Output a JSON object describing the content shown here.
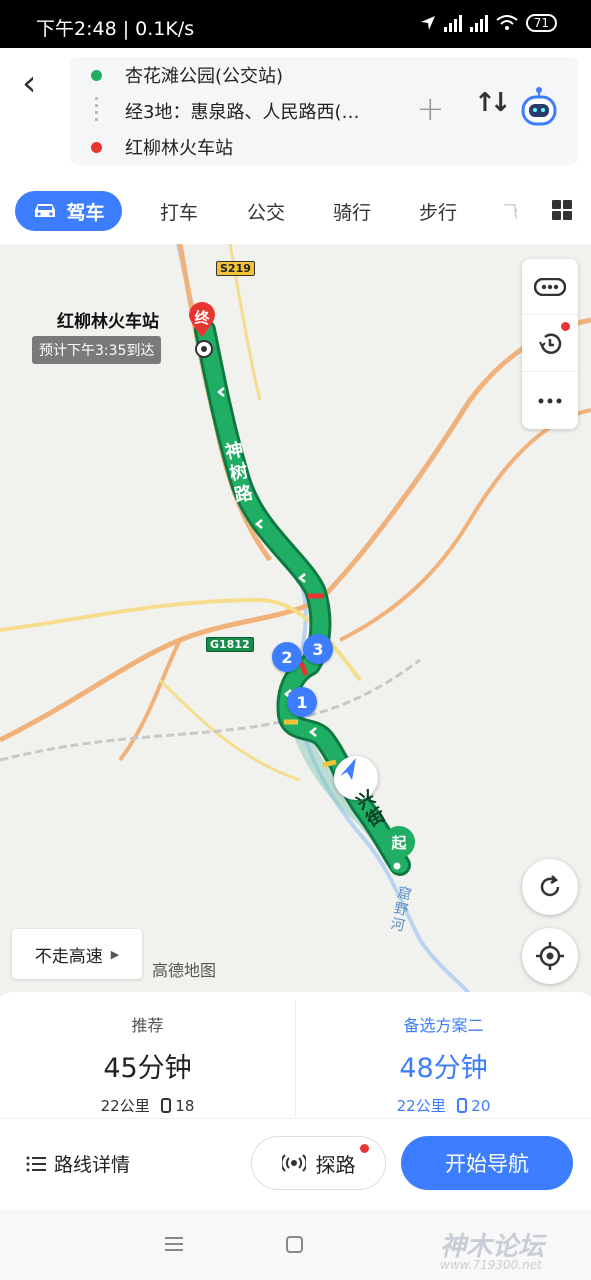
{
  "status_bar": {
    "time": "下午2:48 | 0.1K/s",
    "battery": "71"
  },
  "route": {
    "origin": "杏花滩公园(公交站)",
    "waypoints": "经3地：惠泉路、人民路西(…",
    "destination": "红柳林火车站"
  },
  "modes": {
    "active": "驾车",
    "items": [
      "打车",
      "公交",
      "骑行",
      "步行",
      "飞"
    ]
  },
  "map": {
    "dest_label": "红柳林火车站",
    "dest_marker": "终",
    "origin_marker": "起",
    "eta": "预计下午3:35到达",
    "road_names": [
      "神树路",
      "兴街"
    ],
    "shields": {
      "s219": "S219",
      "g1812": "G1812"
    },
    "waypoint_bubbles": [
      "1",
      "2",
      "3"
    ],
    "river_label": "窟野河",
    "no_highway": "不走高速",
    "logo": "高德地图"
  },
  "routes": [
    {
      "label": "推荐",
      "duration": "45分钟",
      "distance": "22公里",
      "lights": "18",
      "color": "#222222"
    },
    {
      "label": "备选方案二",
      "duration": "48分钟",
      "distance": "22公里",
      "lights": "20",
      "color": "#3d7dff"
    }
  ],
  "actions": {
    "details": "路线详情",
    "explore": "探路",
    "start": "开始导航"
  },
  "watermark": {
    "text": "神木论坛",
    "url": "www.719300.net"
  },
  "colors": {
    "accent": "#3d7dff",
    "route_green": "#1fae64",
    "origin_dot": "#1fae64",
    "dest_dot": "#e8352f"
  }
}
